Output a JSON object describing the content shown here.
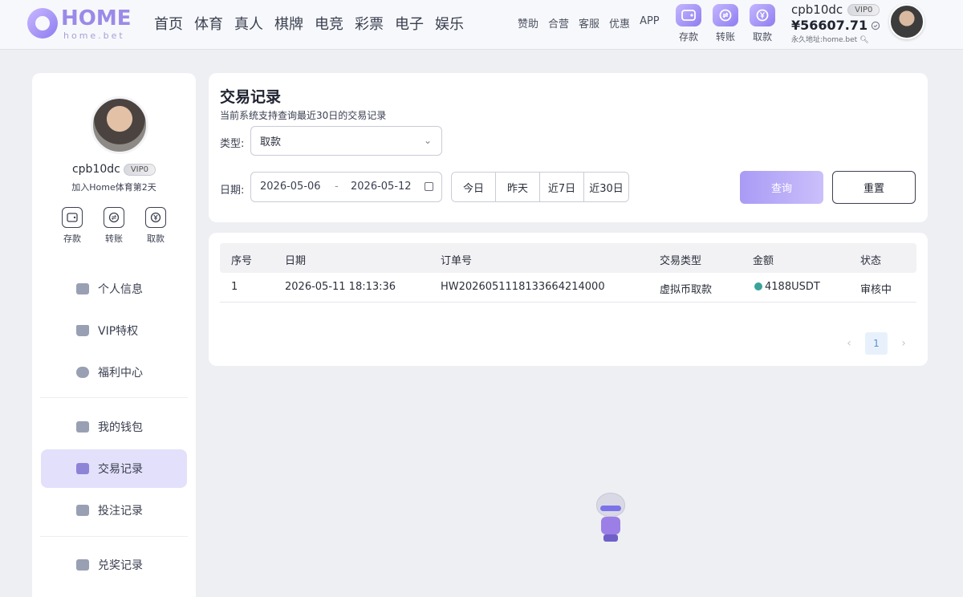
{
  "header": {
    "logo_text": "HOME",
    "logo_sub": "home.bet",
    "nav": [
      "首页",
      "体育",
      "真人",
      "棋牌",
      "电竞",
      "彩票",
      "电子",
      "娱乐"
    ],
    "subnav": [
      "赞助",
      "合营",
      "客服",
      "优惠",
      "APP"
    ],
    "quick_actions": [
      {
        "label": "存款",
        "icon": "wallet-icon"
      },
      {
        "label": "转账",
        "icon": "transfer-icon"
      },
      {
        "label": "取款",
        "icon": "yen-icon"
      }
    ],
    "username": "cpb10dc",
    "vip": "VIP0",
    "balance": "¥56607.71",
    "permanent_address": "永久地址:home.bet"
  },
  "sidebar": {
    "username": "cpb10dc",
    "vip": "VIP0",
    "join_text": "加入Home体育第2天",
    "actions": [
      {
        "label": "存款",
        "icon": "wallet-icon"
      },
      {
        "label": "转账",
        "icon": "transfer-icon"
      },
      {
        "label": "取款",
        "icon": "yen-icon"
      }
    ],
    "menu": [
      {
        "label": "个人信息",
        "icon": "id-card-icon"
      },
      {
        "label": "VIP特权",
        "icon": "crown-icon"
      },
      {
        "label": "福利中心",
        "icon": "ticket-icon"
      },
      {
        "label": "我的钱包",
        "icon": "wallet-icon"
      },
      {
        "label": "交易记录",
        "icon": "records-icon",
        "active": true
      },
      {
        "label": "投注记录",
        "icon": "bet-record-icon"
      },
      {
        "label": "兑奖记录",
        "icon": "gift-icon"
      }
    ]
  },
  "filter": {
    "title": "交易记录",
    "subtitle": "当前系统支持查询最近30日的交易记录",
    "type_label": "类型:",
    "type_value": "取款",
    "date_label": "日期:",
    "date_start": "2026-05-06",
    "date_sep": "-",
    "date_end": "2026-05-12",
    "ranges": [
      "今日",
      "昨天",
      "近7日",
      "近30日"
    ],
    "query_label": "查询",
    "reset_label": "重置"
  },
  "table": {
    "columns": [
      "序号",
      "日期",
      "订单号",
      "交易类型",
      "金额",
      "状态"
    ],
    "rows": [
      {
        "index": "1",
        "date": "2026-05-11 18:13:36",
        "order": "HW2026051118133664214000",
        "type": "虚拟币取款",
        "amount": "4188USDT",
        "status": "审核中"
      }
    ],
    "pagination": {
      "current": "1",
      "prev": "‹",
      "next": "›"
    }
  },
  "colors": {
    "accent": "#a99bf5",
    "active_menu_bg": "#e3e0fb",
    "page_bg": "#eeeff3"
  }
}
